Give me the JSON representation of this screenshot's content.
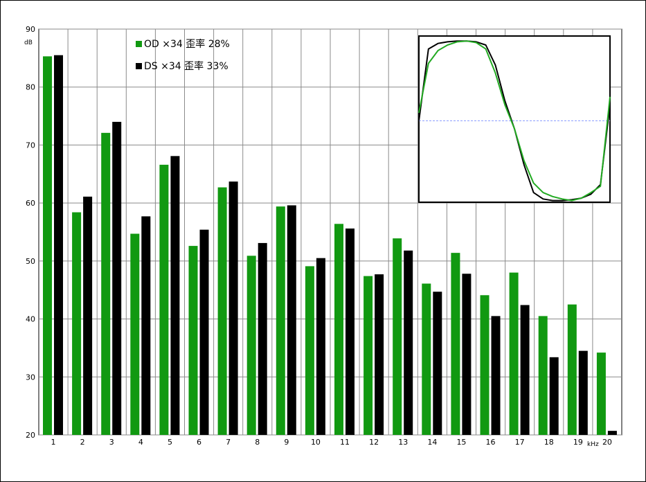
{
  "chart_data": {
    "type": "bar",
    "ylabel": "dB",
    "xlabel": "kHz",
    "ylim": [
      20,
      90
    ],
    "yticks": [
      20,
      30,
      40,
      50,
      60,
      70,
      80,
      90
    ],
    "categories": [
      "1",
      "2",
      "3",
      "4",
      "5",
      "6",
      "7",
      "8",
      "9",
      "10",
      "11",
      "12",
      "13",
      "14",
      "15",
      "16",
      "17",
      "18",
      "19",
      "20"
    ],
    "grid": true,
    "legend_position": "top-left",
    "series": [
      {
        "name": "OD ×34  歪率 28%",
        "color": "#119911",
        "values": [
          85.3,
          58.4,
          72.1,
          54.7,
          66.6,
          52.6,
          62.7,
          50.9,
          59.4,
          49.1,
          56.4,
          47.4,
          53.9,
          46.1,
          51.4,
          44.1,
          48.0,
          40.5,
          42.5,
          34.2
        ]
      },
      {
        "name": "DS ×34  歪率 33%",
        "color": "#000000",
        "values": [
          85.5,
          61.1,
          74.0,
          57.7,
          68.1,
          55.4,
          63.7,
          53.1,
          59.6,
          50.5,
          55.6,
          47.7,
          51.8,
          44.7,
          47.8,
          40.5,
          42.4,
          33.4,
          34.5,
          20.7
        ]
      }
    ],
    "inset": {
      "type": "line",
      "grid": false,
      "x": [
        0,
        0.05,
        0.1,
        0.15,
        0.2,
        0.25,
        0.3,
        0.35,
        0.4,
        0.45,
        0.5,
        0.55,
        0.6,
        0.65,
        0.7,
        0.75,
        0.8,
        0.85,
        0.9,
        0.95,
        1.0
      ],
      "series": [
        {
          "color": "#000000",
          "values": [
            0.0,
            0.9,
            0.97,
            0.99,
            1.0,
            1.0,
            0.99,
            0.95,
            0.7,
            0.25,
            -0.1,
            -0.55,
            -0.9,
            -0.98,
            -1.0,
            -1.0,
            -0.99,
            -0.97,
            -0.92,
            -0.8,
            0.2
          ]
        },
        {
          "color": "#22aa22",
          "values": [
            0.1,
            0.72,
            0.88,
            0.95,
            0.99,
            1.0,
            0.98,
            0.9,
            0.6,
            0.2,
            -0.1,
            -0.5,
            -0.78,
            -0.9,
            -0.95,
            -0.98,
            -1.0,
            -0.97,
            -0.9,
            -0.82,
            0.3
          ]
        }
      ]
    }
  }
}
